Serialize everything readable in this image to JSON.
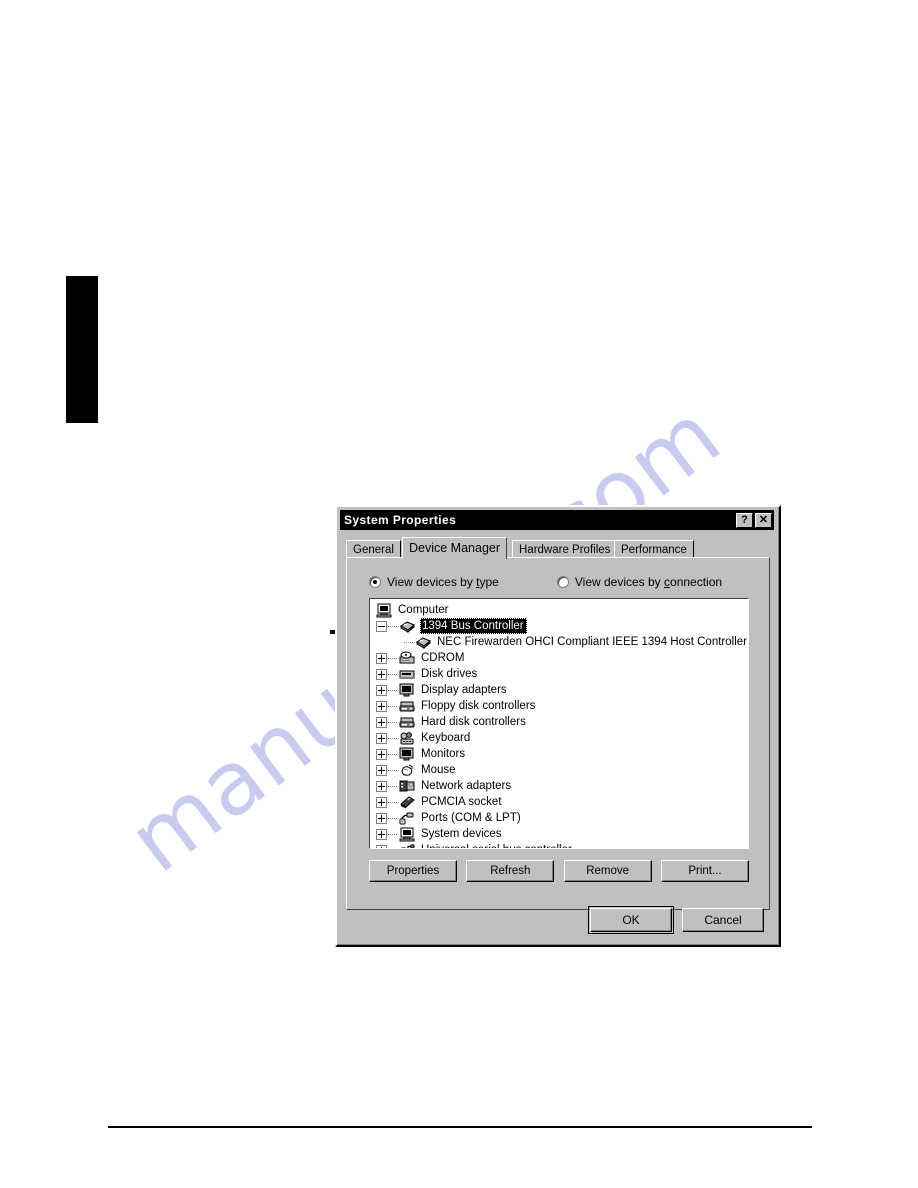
{
  "page": {
    "watermark_text": "manualslib.com",
    "watermark_color": "#c9cbee",
    "marker_color": "#000000"
  },
  "callout": {
    "name": "pointer-arrow",
    "target_row_label": "1394 Bus Controller"
  },
  "dialog": {
    "title": "System Properties",
    "titlebar_color": "#000000",
    "face_color": "#c0c0c0",
    "help_button_label": "?",
    "close_button_label": "✕",
    "tabs": [
      {
        "label": "General",
        "mnemonic": "G",
        "active": false
      },
      {
        "label": "Device Manager",
        "mnemonic": "a",
        "active": true
      },
      {
        "label": "Hardware Profiles",
        "mnemonic": "a",
        "active": false
      },
      {
        "label": "Performance",
        "mnemonic": "",
        "active": false
      }
    ],
    "view_options": [
      {
        "label_pre": "View devices by ",
        "mnemonic": "t",
        "label_post": "ype",
        "checked": true,
        "name": "view-by-type"
      },
      {
        "label_pre": "View devices by ",
        "mnemonic": "c",
        "label_post": "onnection",
        "checked": false,
        "name": "view-by-connection"
      }
    ],
    "tree": [
      {
        "label": "Computer",
        "level": 0,
        "icon": "computer-icon",
        "expander": "none",
        "selected": false
      },
      {
        "label": "1394 Bus Controller",
        "level": 1,
        "icon": "bus-card-icon",
        "expander": "minus",
        "selected": true
      },
      {
        "label": "NEC Firewarden OHCI Compliant IEEE 1394 Host Controller",
        "level": 2,
        "icon": "bus-card-icon",
        "expander": "none",
        "selected": false
      },
      {
        "label": "CDROM",
        "level": 1,
        "icon": "cdrom-icon",
        "expander": "plus",
        "selected": false
      },
      {
        "label": "Disk drives",
        "level": 1,
        "icon": "disk-drive-icon",
        "expander": "plus",
        "selected": false
      },
      {
        "label": "Display adapters",
        "level": 1,
        "icon": "monitor-icon",
        "expander": "plus",
        "selected": false
      },
      {
        "label": "Floppy disk controllers",
        "level": 1,
        "icon": "controller-icon",
        "expander": "plus",
        "selected": false
      },
      {
        "label": "Hard disk controllers",
        "level": 1,
        "icon": "controller-icon",
        "expander": "plus",
        "selected": false
      },
      {
        "label": "Keyboard",
        "level": 1,
        "icon": "keyboard-icon",
        "expander": "plus",
        "selected": false
      },
      {
        "label": "Monitors",
        "level": 1,
        "icon": "monitor-icon",
        "expander": "plus",
        "selected": false
      },
      {
        "label": "Mouse",
        "level": 1,
        "icon": "mouse-icon",
        "expander": "plus",
        "selected": false
      },
      {
        "label": "Network adapters",
        "level": 1,
        "icon": "network-card-icon",
        "expander": "plus",
        "selected": false
      },
      {
        "label": "PCMCIA socket",
        "level": 1,
        "icon": "pcmcia-card-icon",
        "expander": "plus",
        "selected": false
      },
      {
        "label": "Ports (COM & LPT)",
        "level": 1,
        "icon": "port-plug-icon",
        "expander": "plus",
        "selected": false
      },
      {
        "label": "System devices",
        "level": 1,
        "icon": "computer-icon",
        "expander": "plus",
        "selected": false
      },
      {
        "label": "Universal serial bus controller",
        "level": 1,
        "icon": "usb-icon",
        "expander": "plus",
        "selected": false
      }
    ],
    "command_buttons": [
      {
        "label": "Properties",
        "mnemonic": "r",
        "name": "properties-button"
      },
      {
        "label": "Refresh",
        "mnemonic": "f",
        "name": "refresh-button"
      },
      {
        "label": "Remove",
        "mnemonic": "e",
        "name": "remove-button"
      },
      {
        "label": "Print...",
        "mnemonic": "n",
        "name": "print-button"
      }
    ],
    "footer_buttons": [
      {
        "label": "OK",
        "default": true,
        "name": "ok-button"
      },
      {
        "label": "Cancel",
        "default": false,
        "name": "cancel-button"
      }
    ]
  }
}
